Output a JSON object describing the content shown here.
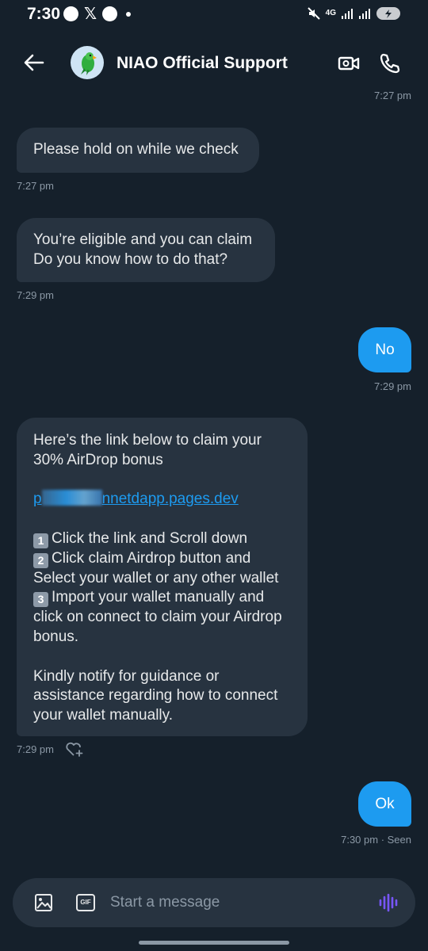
{
  "status_bar": {
    "time": "7:30",
    "x_logo": "𝕏",
    "network": "4G"
  },
  "header": {
    "title": "NIAO Official Support"
  },
  "messages": {
    "top_ts": "7:27 pm",
    "m1": {
      "text": "Please hold on while we check",
      "ts": "7:27 pm"
    },
    "m2": {
      "line1": "You’re eligible and you can claim",
      "line2": "Do you know how to do that?",
      "ts": "7:29 pm"
    },
    "m3": {
      "text": "No",
      "ts": "7:29 pm"
    },
    "m4": {
      "l1": "Here’s the link below to claim your",
      "l2": "30% AirDrop bonus",
      "link_prefix": "p",
      "link_suffix": "nnetdapp.pages.dev",
      "k1": "1",
      "s1": "Click the link and Scroll down",
      "k2": "2",
      "s2": "Click claim Airdrop button and",
      "s2b": "Select your wallet or any other wallet",
      "k3": "3",
      "s3": "Import your wallet manually and",
      "s3b": "click on connect to claim your Airdrop",
      "s3c": "bonus.",
      "n1": "Kindly notify for guidance or",
      "n2": "assistance regarding how to connect",
      "n3": "your wallet manually.",
      "ts": "7:29 pm"
    },
    "m5": {
      "text": "Ok",
      "ts": "7:30 pm · Seen"
    }
  },
  "composer": {
    "placeholder": "Start a message",
    "gif_label": "GIF"
  }
}
